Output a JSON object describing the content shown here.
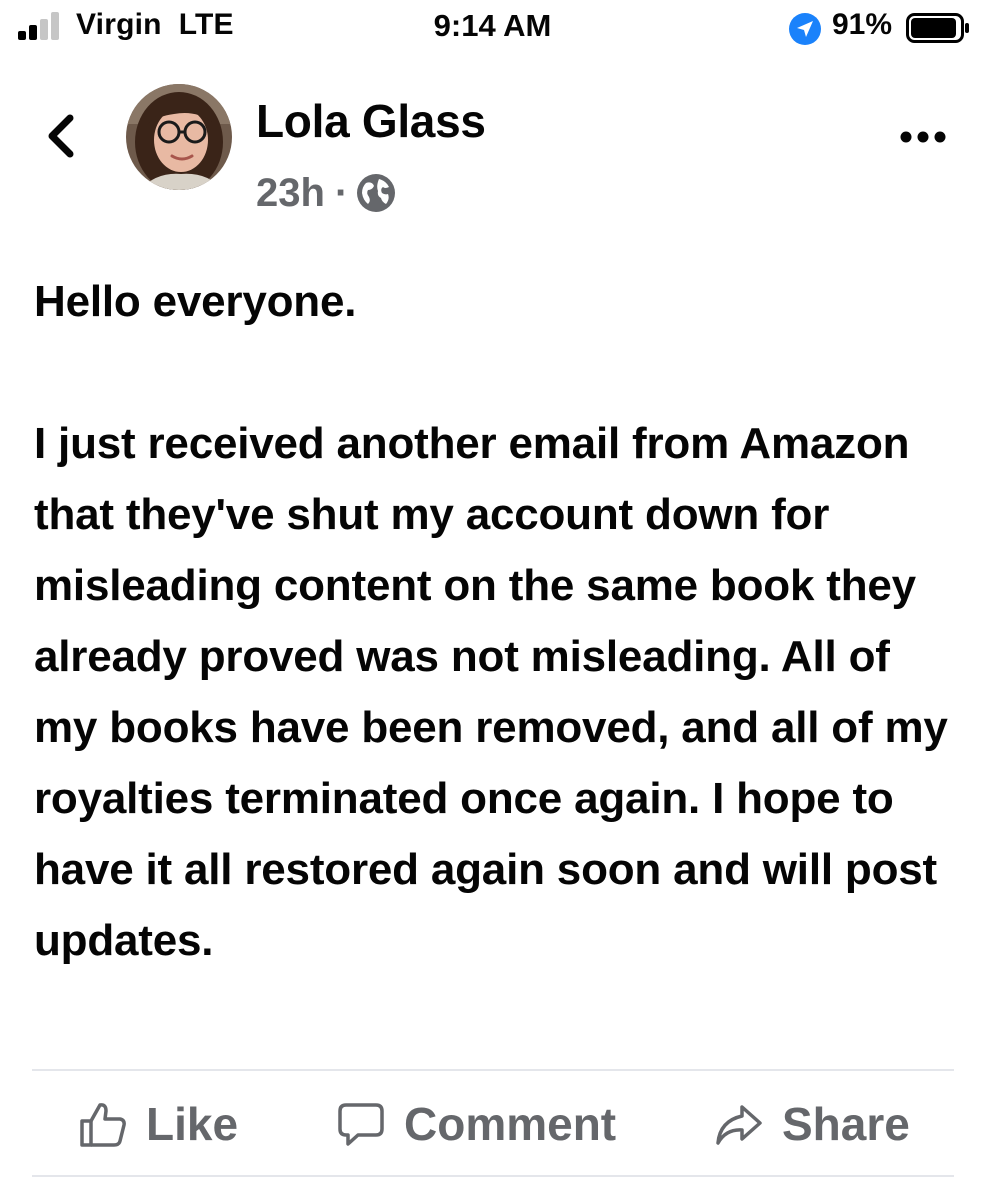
{
  "status_bar": {
    "carrier": "Virgin  LTE",
    "time": "9:14 AM",
    "battery_percent": "91%",
    "battery_level": 0.91,
    "signal_bars": 2,
    "icons": [
      "signal-icon",
      "location-icon",
      "battery-icon"
    ]
  },
  "post": {
    "author": "Lola Glass",
    "timestamp": "23h",
    "separator": "·",
    "privacy_icon": "globe-icon",
    "greeting": "Hello everyone.",
    "message": "I just received another email from Amazon that they've shut my account down for misleading content on the same book they already proved was not misleading. All of my books have been removed, and all of my royalties terminated once again. I hope to have it all restored again soon and will post updates."
  },
  "actions": {
    "like": "Like",
    "comment": "Comment",
    "share": "Share"
  },
  "colors": {
    "text": "#050505",
    "secondary_text": "#65676b",
    "divider": "#e4e6eb",
    "location_blue": "#1a82fb"
  }
}
